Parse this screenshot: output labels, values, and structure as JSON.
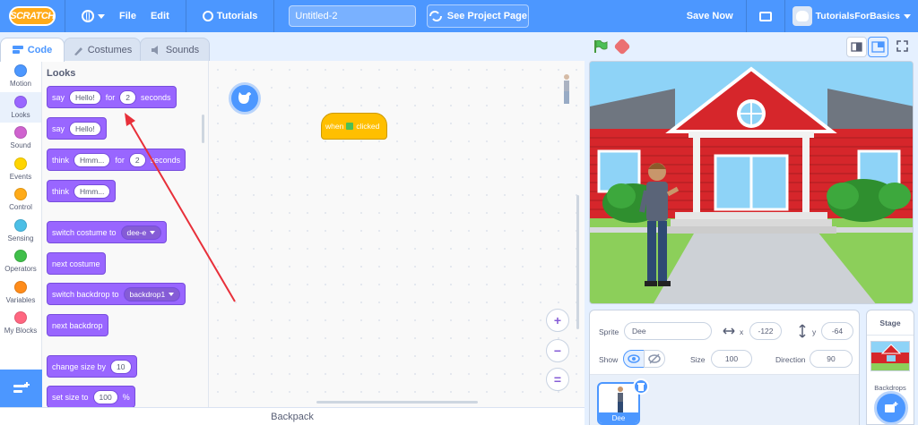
{
  "menubar": {
    "logo": "SCRATCH",
    "file": "File",
    "edit": "Edit",
    "tutorials": "Tutorials",
    "project_title": "Untitled-2",
    "see_project": "See Project Page",
    "save_now": "Save Now",
    "username": "TutorialsForBasics"
  },
  "tabs": {
    "code": "Code",
    "costumes": "Costumes",
    "sounds": "Sounds"
  },
  "categories": [
    {
      "label": "Motion",
      "color": "#4c97ff"
    },
    {
      "label": "Looks",
      "color": "#9966ff"
    },
    {
      "label": "Sound",
      "color": "#cf63cf"
    },
    {
      "label": "Events",
      "color": "#ffd500"
    },
    {
      "label": "Control",
      "color": "#ffab19"
    },
    {
      "label": "Sensing",
      "color": "#4cbfe6"
    },
    {
      "label": "Operators",
      "color": "#40bf4a"
    },
    {
      "label": "Variables",
      "color": "#ff8c1a"
    },
    {
      "label": "My Blocks",
      "color": "#ff6680"
    }
  ],
  "palette": {
    "title": "Looks",
    "say_for": {
      "say": "say",
      "msg": "Hello!",
      "for": "for",
      "secs": "2",
      "seconds": "seconds"
    },
    "say": {
      "say": "say",
      "msg": "Hello!"
    },
    "think_for": {
      "think": "think",
      "msg": "Hmm...",
      "for": "for",
      "secs": "2",
      "seconds": "seconds"
    },
    "think": {
      "think": "think",
      "msg": "Hmm..."
    },
    "switch_costume": {
      "label": "switch costume to",
      "value": "dee-e"
    },
    "next_costume": "next costume",
    "switch_backdrop": {
      "label": "switch backdrop to",
      "value": "backdrop1"
    },
    "next_backdrop": "next backdrop",
    "change_size": {
      "label": "change size by",
      "value": "10"
    },
    "set_size": {
      "label": "set size to",
      "value": "100",
      "unit": "%"
    }
  },
  "script": {
    "hat_when": "when",
    "hat_clicked": "clicked"
  },
  "zoom": {
    "in": "+",
    "out": "−",
    "reset": "="
  },
  "backpack": "Backpack",
  "sprite_info": {
    "sprite_label": "Sprite",
    "sprite_name": "Dee",
    "x_label": "x",
    "x_value": "-122",
    "y_label": "y",
    "y_value": "-64",
    "show_label": "Show",
    "size_label": "Size",
    "size_value": "100",
    "direction_label": "Direction",
    "direction_value": "90"
  },
  "sprite_list": [
    {
      "name": "Dee"
    }
  ],
  "stage_pane": {
    "title": "Stage",
    "backdrops": "Backdrops"
  },
  "colors": {
    "accent": "#4c97ff",
    "looks": "#9966ff",
    "events": "#ffbf00",
    "annotation_arrow": "#e8303a"
  }
}
